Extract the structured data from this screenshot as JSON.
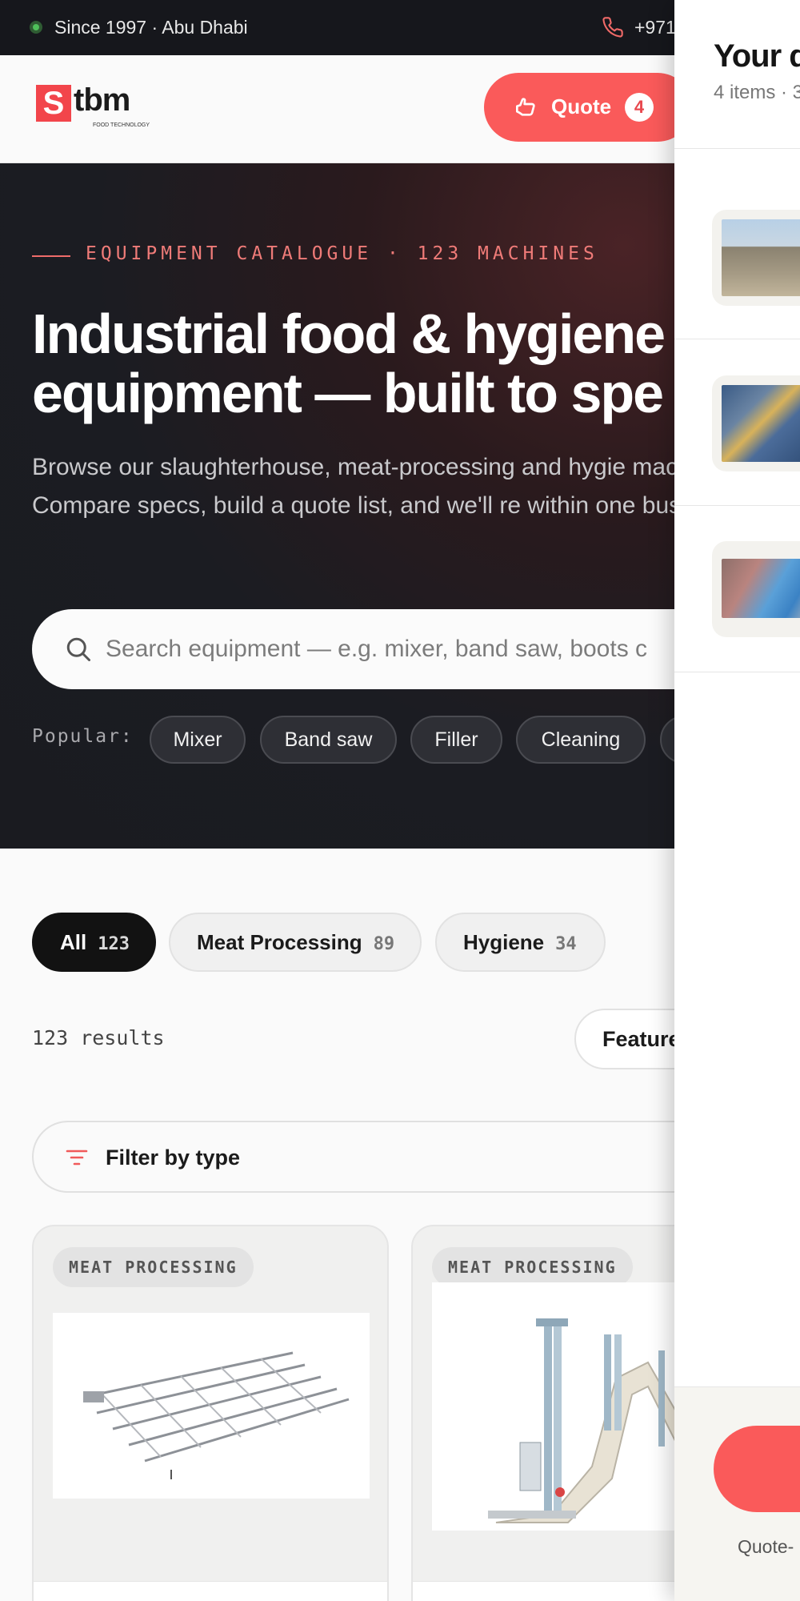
{
  "topbar": {
    "since": "Since 1997 · Abu Dhabi",
    "phone": "+971"
  },
  "header": {
    "logo": {
      "letter": "S",
      "word": "tbm",
      "tagline": "FOOD TECHNOLOGY"
    },
    "quote": {
      "label": "Quote",
      "count": "4"
    }
  },
  "hero": {
    "eyebrow": "EQUIPMENT CATALOGUE · 123 MACHINES",
    "title": "Industrial food & hygiene\nequipment — built to spe",
    "description": "Browse our slaughterhouse, meat-processing and hygie machinery. Compare specs, build a quote list, and we'll re within one business day.",
    "search_placeholder": "Search equipment — e.g. mixer, band saw, boots c",
    "popular_label": "Popular:",
    "popular": [
      "Mixer",
      "Band saw",
      "Filler",
      "Cleaning"
    ]
  },
  "tabs": [
    {
      "label": "All",
      "count": "123"
    },
    {
      "label": "Meat Processing",
      "count": "89"
    },
    {
      "label": "Hygiene",
      "count": "34"
    }
  ],
  "results": {
    "count_text": "123 results",
    "sort_label": "Feature"
  },
  "filter": {
    "label": "Filter by type"
  },
  "cards": [
    {
      "category": "MEAT PROCESSING"
    },
    {
      "category": "MEAT PROCESSING"
    }
  ],
  "drawer": {
    "title": "Your q",
    "subtitle": "4 items · 3",
    "note": "Quote-"
  },
  "colors": {
    "accent": "#fa5a5a",
    "dark": "#16171c",
    "status_green": "#4fc15a"
  }
}
